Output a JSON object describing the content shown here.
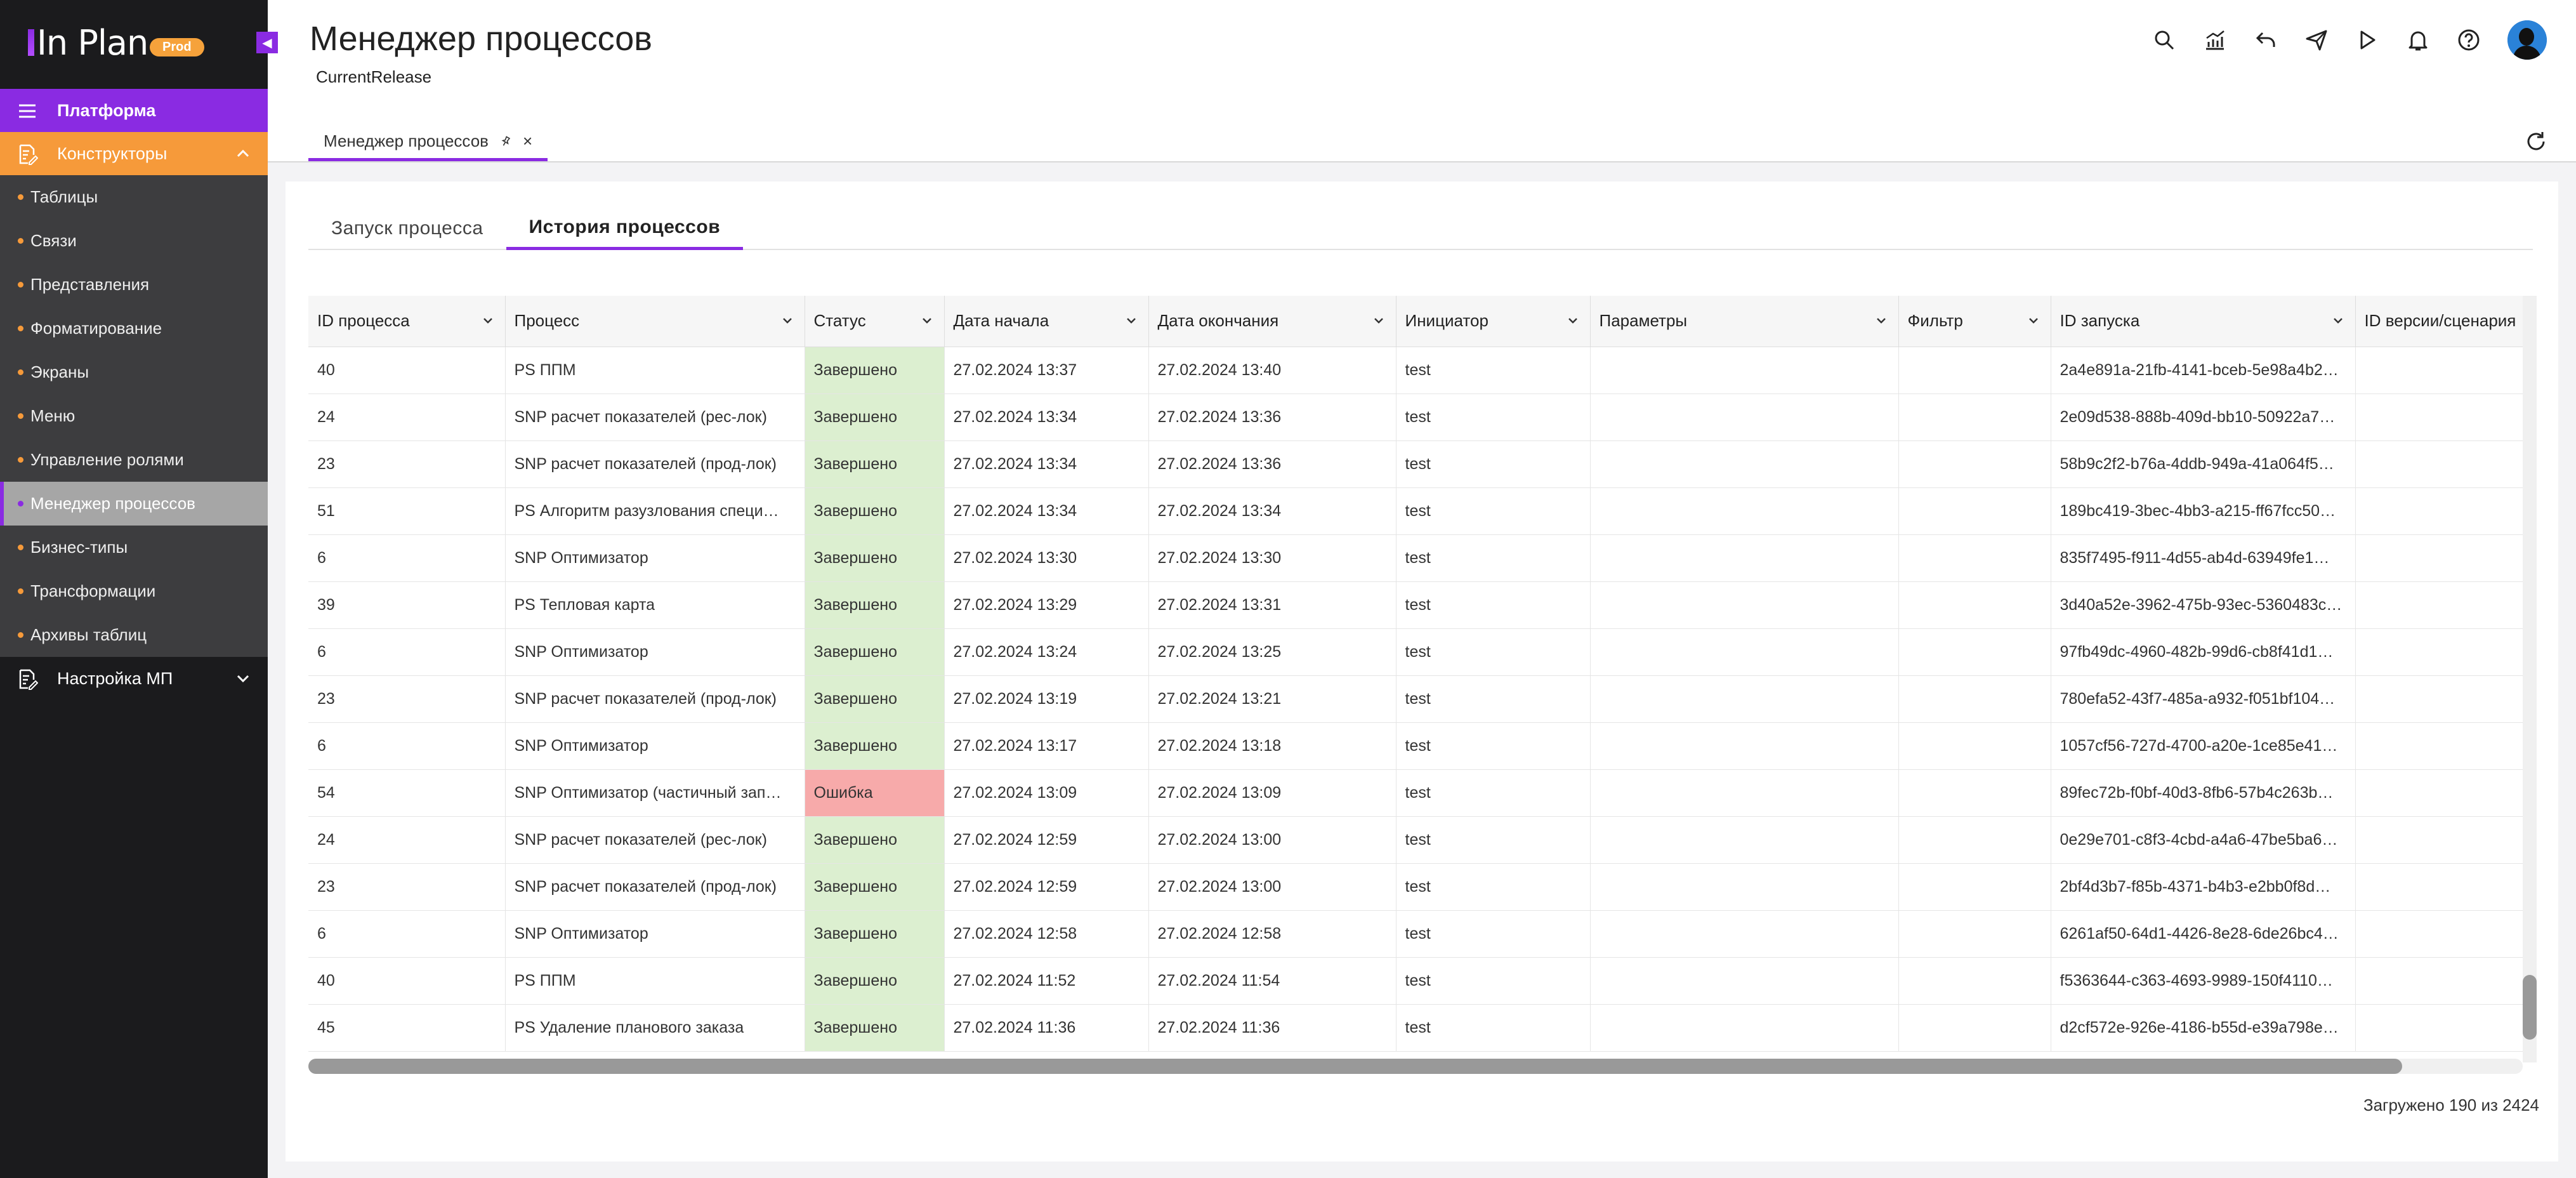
{
  "app": {
    "logo": "In Plan",
    "env_badge": "Prod"
  },
  "sidebar": {
    "platform_label": "Платформа",
    "constructors_label": "Конструкторы",
    "items": [
      {
        "label": "Таблицы"
      },
      {
        "label": "Связи"
      },
      {
        "label": "Представления"
      },
      {
        "label": "Форматирование"
      },
      {
        "label": "Экраны"
      },
      {
        "label": "Меню"
      },
      {
        "label": "Управление ролями"
      },
      {
        "label": "Менеджер процессов",
        "active": true
      },
      {
        "label": "Бизнес-типы"
      },
      {
        "label": "Трансформации"
      },
      {
        "label": "Архивы таблиц"
      }
    ],
    "settings_label": "Настройка МП"
  },
  "header": {
    "title": "Менеджер процессов",
    "release": "CurrentRelease",
    "open_tab": "Менеджер процессов",
    "toolbar_icons": [
      "search-icon",
      "chart-icon",
      "undo-icon",
      "send-icon",
      "play-icon",
      "bell-icon",
      "help-icon",
      "avatar"
    ]
  },
  "tabs": [
    {
      "label": "Запуск процесса",
      "active": false
    },
    {
      "label": "История процессов",
      "active": true
    }
  ],
  "table": {
    "columns": [
      "ID процесса",
      "Процесс",
      "Статус",
      "Дата начала",
      "Дата окончания",
      "Инициатор",
      "Параметры",
      "Фильтр",
      "ID запуска",
      "ID версии/сценария"
    ],
    "rows": [
      [
        "40",
        "PS ППМ",
        "Завершено",
        "27.02.2024 13:37",
        "27.02.2024 13:40",
        "test",
        "",
        "",
        "2a4e891a-21fb-4141-bceb-5e98a4b2…"
      ],
      [
        "24",
        "SNP расчет показателей (рес-лок)",
        "Завершено",
        "27.02.2024 13:34",
        "27.02.2024 13:36",
        "test",
        "",
        "",
        "2e09d538-888b-409d-bb10-50922a7…"
      ],
      [
        "23",
        "SNP расчет показателей (прод-лок)",
        "Завершено",
        "27.02.2024 13:34",
        "27.02.2024 13:36",
        "test",
        "",
        "",
        "58b9c2f2-b76a-4ddb-949a-41a064f5…"
      ],
      [
        "51",
        "PS Алгоритм разузлования специ…",
        "Завершено",
        "27.02.2024 13:34",
        "27.02.2024 13:34",
        "test",
        "",
        "",
        "189bc419-3bec-4bb3-a215-ff67fcc50…"
      ],
      [
        "6",
        "SNP Оптимизатор",
        "Завершено",
        "27.02.2024 13:30",
        "27.02.2024 13:30",
        "test",
        "",
        "",
        "835f7495-f911-4d55-ab4d-63949fe1…"
      ],
      [
        "39",
        "PS Тепловая карта",
        "Завершено",
        "27.02.2024 13:29",
        "27.02.2024 13:31",
        "test",
        "",
        "",
        "3d40a52e-3962-475b-93ec-5360483c…"
      ],
      [
        "6",
        "SNP Оптимизатор",
        "Завершено",
        "27.02.2024 13:24",
        "27.02.2024 13:25",
        "test",
        "",
        "",
        "97fb49dc-4960-482b-99d6-cb8f41d1…"
      ],
      [
        "23",
        "SNP расчет показателей (прод-лок)",
        "Завершено",
        "27.02.2024 13:19",
        "27.02.2024 13:21",
        "test",
        "",
        "",
        "780efa52-43f7-485a-a932-f051bf104…"
      ],
      [
        "6",
        "SNP Оптимизатор",
        "Завершено",
        "27.02.2024 13:17",
        "27.02.2024 13:18",
        "test",
        "",
        "",
        "1057cf56-727d-4700-a20e-1ce85e41…"
      ],
      [
        "54",
        "SNP Оптимизатор (частичный зап…",
        "Ошибка",
        "27.02.2024 13:09",
        "27.02.2024 13:09",
        "test",
        "",
        "",
        "89fec72b-f0bf-40d3-8fb6-57b4c263b…"
      ],
      [
        "24",
        "SNP расчет показателей (рес-лок)",
        "Завершено",
        "27.02.2024 12:59",
        "27.02.2024 13:00",
        "test",
        "",
        "",
        "0e29e701-c8f3-4cbd-a4a6-47be5ba6…"
      ],
      [
        "23",
        "SNP расчет показателей (прод-лок)",
        "Завершено",
        "27.02.2024 12:59",
        "27.02.2024 13:00",
        "test",
        "",
        "",
        "2bf4d3b7-f85b-4371-b4b3-e2bb0f8d…"
      ],
      [
        "6",
        "SNP Оптимизатор",
        "Завершено",
        "27.02.2024 12:58",
        "27.02.2024 12:58",
        "test",
        "",
        "",
        "6261af50-64d1-4426-8e28-6de26bc4…"
      ],
      [
        "40",
        "PS ППМ",
        "Завершено",
        "27.02.2024 11:52",
        "27.02.2024 11:54",
        "test",
        "",
        "",
        "f5363644-c363-4693-9989-150f4110…"
      ],
      [
        "45",
        "PS Удаление планового заказа",
        "Завершено",
        "27.02.2024 11:36",
        "27.02.2024 11:36",
        "test",
        "",
        "",
        "d2cf572e-926e-4186-b55d-e39a798e…"
      ]
    ]
  },
  "status_colors": {
    "Завершено": "#dcefd0",
    "Ошибка": "#f7aaaa"
  },
  "footer": {
    "loaded": "Загружено 190 из 2424"
  }
}
